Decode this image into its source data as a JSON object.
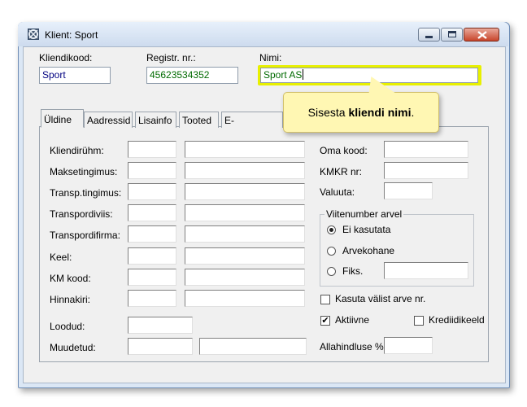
{
  "window": {
    "title": "Klient: Sport",
    "controls": [
      "minimize",
      "maximize",
      "close"
    ]
  },
  "header": {
    "code_label": "Kliendikood:",
    "code_value": "Sport",
    "reg_label": "Registr. nr.:",
    "reg_value": "45623534352",
    "name_label": "Nimi:",
    "name_value": "Sport AS"
  },
  "tooltip": {
    "prefix": "Sisesta ",
    "bold": "kliendi nimi",
    "suffix": "."
  },
  "tabs": [
    {
      "label": "Üldine"
    },
    {
      "label": "Aadressid"
    },
    {
      "label": "Lisainfo"
    },
    {
      "label": "Tooted"
    },
    {
      "label": "E-dokumendid"
    }
  ],
  "left_fields": [
    {
      "label": "Kliendirühm:"
    },
    {
      "label": "Maksetingimus:"
    },
    {
      "label": "Transp.tingimus:"
    },
    {
      "label": "Transpordiviis:"
    },
    {
      "label": "Transpordifirma:"
    },
    {
      "label": "Keel:"
    },
    {
      "label": "KM kood:"
    },
    {
      "label": "Hinnakiri:"
    }
  ],
  "audit": {
    "created_label": "Loodud:",
    "modified_label": "Muudetud:"
  },
  "right_fields": {
    "own_code_label": "Oma kood:",
    "kmkr_label": "KMKR nr:",
    "currency_label": "Valuuta:"
  },
  "reference_group": {
    "title": "Viitenumber arvel",
    "options": [
      {
        "label": "Ei kasutata",
        "selected": true
      },
      {
        "label": "Arvekohane",
        "selected": false
      },
      {
        "label": "Fiks.",
        "selected": false
      }
    ]
  },
  "checkboxes": {
    "external_invoice": {
      "label": "Kasuta välist arve nr.",
      "checked": false
    },
    "active": {
      "label": "Aktiivne",
      "checked": true
    },
    "credit_block": {
      "label": "Krediidikeeld",
      "checked": false
    }
  },
  "discount_label": "Allahindluse %:",
  "colors": {
    "highlight": "#e8f000",
    "name_text": "#006a00",
    "reg_text": "#006a00",
    "code_text": "#000080",
    "tooltip_bg": "#fff7b3"
  }
}
